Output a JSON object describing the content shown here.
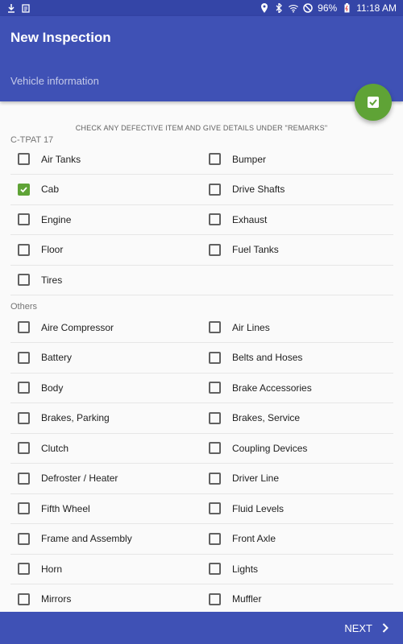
{
  "status_bar": {
    "battery": "96%",
    "time": "11:18 AM"
  },
  "app_bar": {
    "title": "New Inspection",
    "subtitle": "Vehicle information"
  },
  "instruction": "CHECK ANY DEFECTIVE ITEM AND GIVE DETAILS UNDER \"REMARKS\"",
  "sections": [
    {
      "header": "C-TPAT 17",
      "items": [
        {
          "label": "Air Tanks",
          "checked": false
        },
        {
          "label": "Bumper",
          "checked": false
        },
        {
          "label": "Cab",
          "checked": true
        },
        {
          "label": "Drive Shafts",
          "checked": false
        },
        {
          "label": "Engine",
          "checked": false
        },
        {
          "label": "Exhaust",
          "checked": false
        },
        {
          "label": "Floor",
          "checked": false
        },
        {
          "label": "Fuel Tanks",
          "checked": false
        },
        {
          "label": "Tires",
          "checked": false
        }
      ]
    },
    {
      "header": "Others",
      "items": [
        {
          "label": "Aire Compressor",
          "checked": false
        },
        {
          "label": "Air Lines",
          "checked": false
        },
        {
          "label": "Battery",
          "checked": false
        },
        {
          "label": "Belts and Hoses",
          "checked": false
        },
        {
          "label": "Body",
          "checked": false
        },
        {
          "label": "Brake Accessories",
          "checked": false
        },
        {
          "label": "Brakes, Parking",
          "checked": false
        },
        {
          "label": "Brakes, Service",
          "checked": false
        },
        {
          "label": "Clutch",
          "checked": false
        },
        {
          "label": "Coupling Devices",
          "checked": false
        },
        {
          "label": "Defroster / Heater",
          "checked": false
        },
        {
          "label": "Driver Line",
          "checked": false
        },
        {
          "label": "Fifth Wheel",
          "checked": false
        },
        {
          "label": "Fluid Levels",
          "checked": false
        },
        {
          "label": "Frame and Assembly",
          "checked": false
        },
        {
          "label": "Front Axle",
          "checked": false
        },
        {
          "label": "Horn",
          "checked": false
        },
        {
          "label": "Lights",
          "checked": false
        },
        {
          "label": "Mirrors",
          "checked": false
        },
        {
          "label": "Muffler",
          "checked": false
        }
      ]
    }
  ],
  "bottom_bar": {
    "next_label": "NEXT"
  },
  "colors": {
    "primary": "#3f51b5",
    "status_bar": "#3445a7",
    "accent": "#5fa336"
  }
}
